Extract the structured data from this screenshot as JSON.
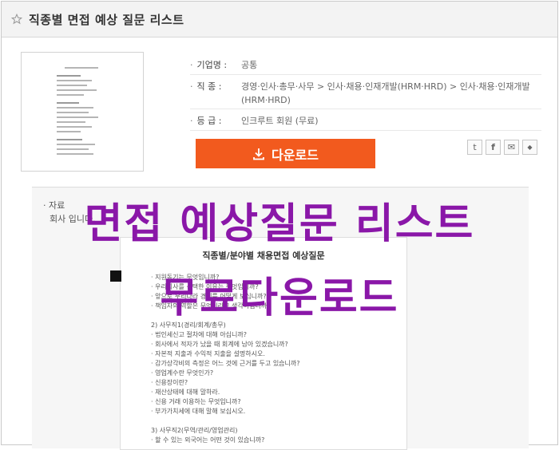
{
  "header": {
    "title": "직종별 면접 예상 질문 리스트"
  },
  "info": {
    "company_label": "기업명 :",
    "company_value": "공통",
    "job_label": "직 종 :",
    "job_value": "경영·인사·총무·사무 > 인사·채용·인재개발(HRM·HRD) > 인사·채용·인재개발(HRM·HRD)",
    "grade_label": "등 급 :",
    "grade_value": "인크루트 회원 (무료)"
  },
  "download": {
    "label": "다운로드"
  },
  "share_icons": [
    "twitter-icon",
    "facebook-icon",
    "email-icon",
    "bookmark-icon"
  ],
  "share_glyphs": [
    "t",
    "f",
    "✉",
    "◆"
  ],
  "preview": {
    "line1": "· 자료",
    "line2": "회사                                                                                     입니다.",
    "doc_title": "직종별/분야별 채용면접 예상질문",
    "doc_lines": [
      "· 지원동기는 무엇입니까?",
      "· 우리회사를 선택한 이유는 무엇입니까?",
      "· 앞으로 우리나라 경제를 어떻게 보십니까?",
      "· 책임자의 역할은 무엇이라고 생각하십니까?",
      "",
      "2) 사무직1(경리/회계/총무)",
      "· 법인세신고 절차에 대해 아십니까?",
      "· 회사에서 적자가 났을 때 회계에 남아 있겠습니까?",
      "· 자본적 지출과 수익적 지출을 설명하시오.",
      "· 감가상각비의 측정은 어느 것에 근거를 두고 있습니까?",
      "· 영업계수란 무엇인가?",
      "· 신용장이란?",
      "· 재산상태에 대해 말하라.",
      "· 신용 거래 이용하는 무엇입니까?",
      "· 부가가치세에 대해 말해 보십시오.",
      "",
      "3) 사무직2(무역/관리/영업관리)",
      "· 할 수 있는 외국어는 어떤 것이 있습니까?"
    ]
  },
  "overlay": {
    "line1": "면접 예상질문 리스트",
    "line2": "무료다운로드"
  }
}
